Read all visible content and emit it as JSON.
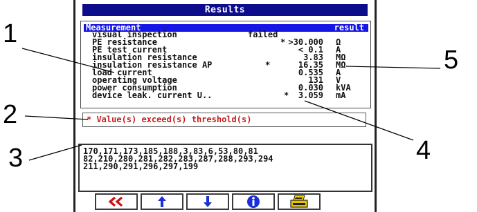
{
  "window": {
    "title": "Results"
  },
  "table": {
    "header_name": "Measurement",
    "header_result": "result",
    "rows": [
      {
        "name": "visual inspection",
        "mark": "",
        "value": "failed",
        "unit": ""
      },
      {
        "name": "PE resistance",
        "mark": "*",
        "value": ">30.000",
        "unit": "Ω"
      },
      {
        "name": "PE test current",
        "mark": "",
        "value": "< 0.1",
        "unit": "A"
      },
      {
        "name": "insulation resistance",
        "mark": "",
        "value": "3.83",
        "unit": "MΩ"
      },
      {
        "name": "insulation resistance AP",
        "mark": "*",
        "value": "16.35",
        "unit": "MΩ"
      },
      {
        "name": "load current",
        "mark": "",
        "value": "0.535",
        "unit": "A"
      },
      {
        "name": "operating voltage",
        "mark": "",
        "value": "131",
        "unit": "V"
      },
      {
        "name": "power consumption",
        "mark": "",
        "value": "0.030",
        "unit": "kVA"
      },
      {
        "name": "device leak. current U..",
        "mark": "*",
        "value": "3.059",
        "unit": "mA"
      }
    ]
  },
  "warning": {
    "text": "* Value(s) exceed(s) threshold(s)"
  },
  "codes": {
    "lines": [
      "170,171,173,185,188,3,83,6,53,80,81",
      "82,210,280,281,282,283,287,288,293,294",
      "211,290,291,296,297,199"
    ]
  },
  "toolbar": {
    "buttons": [
      {
        "icon": "double-chevron-left-icon"
      },
      {
        "icon": "arrow-up-icon"
      },
      {
        "icon": "arrow-down-icon"
      },
      {
        "icon": "info-icon"
      },
      {
        "icon": "printer-icon"
      }
    ]
  },
  "callouts": [
    "1",
    "2",
    "3",
    "4",
    "5"
  ],
  "colors": {
    "title_bg": "#0d0d8c",
    "header_bg": "#1515e6",
    "warning": "#c42020",
    "icon_red": "#cc1111",
    "icon_blue": "#1b2fd6"
  }
}
